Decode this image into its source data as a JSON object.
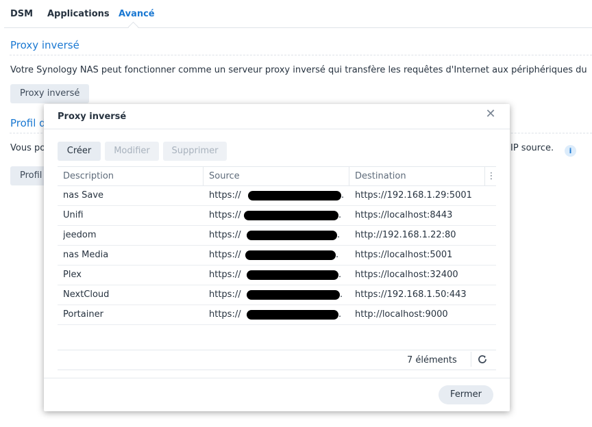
{
  "tabs": [
    {
      "label": "DSM"
    },
    {
      "label": "Applications"
    },
    {
      "label": "Avancé"
    }
  ],
  "section1": {
    "title": "Proxy inversé",
    "description": "Votre Synology NAS peut fonctionner comme un serveur proxy inversé qui transfère les requêtes d'Internet aux périphériques du",
    "button_label": "Proxy inversé"
  },
  "section2": {
    "title": "Profil d",
    "description_start": "Vous po",
    "description_end": "IP source.",
    "button_label": "Profil"
  },
  "modal": {
    "title": "Proxy inversé",
    "toolbar": {
      "create_label": "Créer",
      "edit_label": "Modifier",
      "delete_label": "Supprimer"
    },
    "columns": [
      "Description",
      "Source",
      "Destination"
    ],
    "rows": [
      {
        "description": "nas Save",
        "source": "https://",
        "source_tail": ".",
        "destination": "https://192.168.1.29:5001"
      },
      {
        "description": "Unifi",
        "source": "https://",
        "source_tail": ".",
        "destination": "https://localhost:8443"
      },
      {
        "description": "jeedom",
        "source": "https://",
        "source_tail": ".",
        "destination": "http://192.168.1.22:80"
      },
      {
        "description": "nas Media",
        "source": "https://",
        "source_tail": ".",
        "destination": "https://localhost:5001"
      },
      {
        "description": "Plex",
        "source": "https://",
        "source_tail": ".",
        "destination": "https://localhost:32400"
      },
      {
        "description": "NextCloud",
        "source": "https://",
        "source_tail": ".",
        "destination": "https://192.168.1.50:443"
      },
      {
        "description": "Portainer",
        "source": "https://",
        "source_tail": ".",
        "destination": "http://localhost:9000"
      }
    ],
    "count_label": "7 éléments",
    "close_label": "Fermer"
  },
  "colors": {
    "accent": "#1a78d2",
    "button_bg": "#e7ecf2",
    "redaction": "#000000"
  }
}
